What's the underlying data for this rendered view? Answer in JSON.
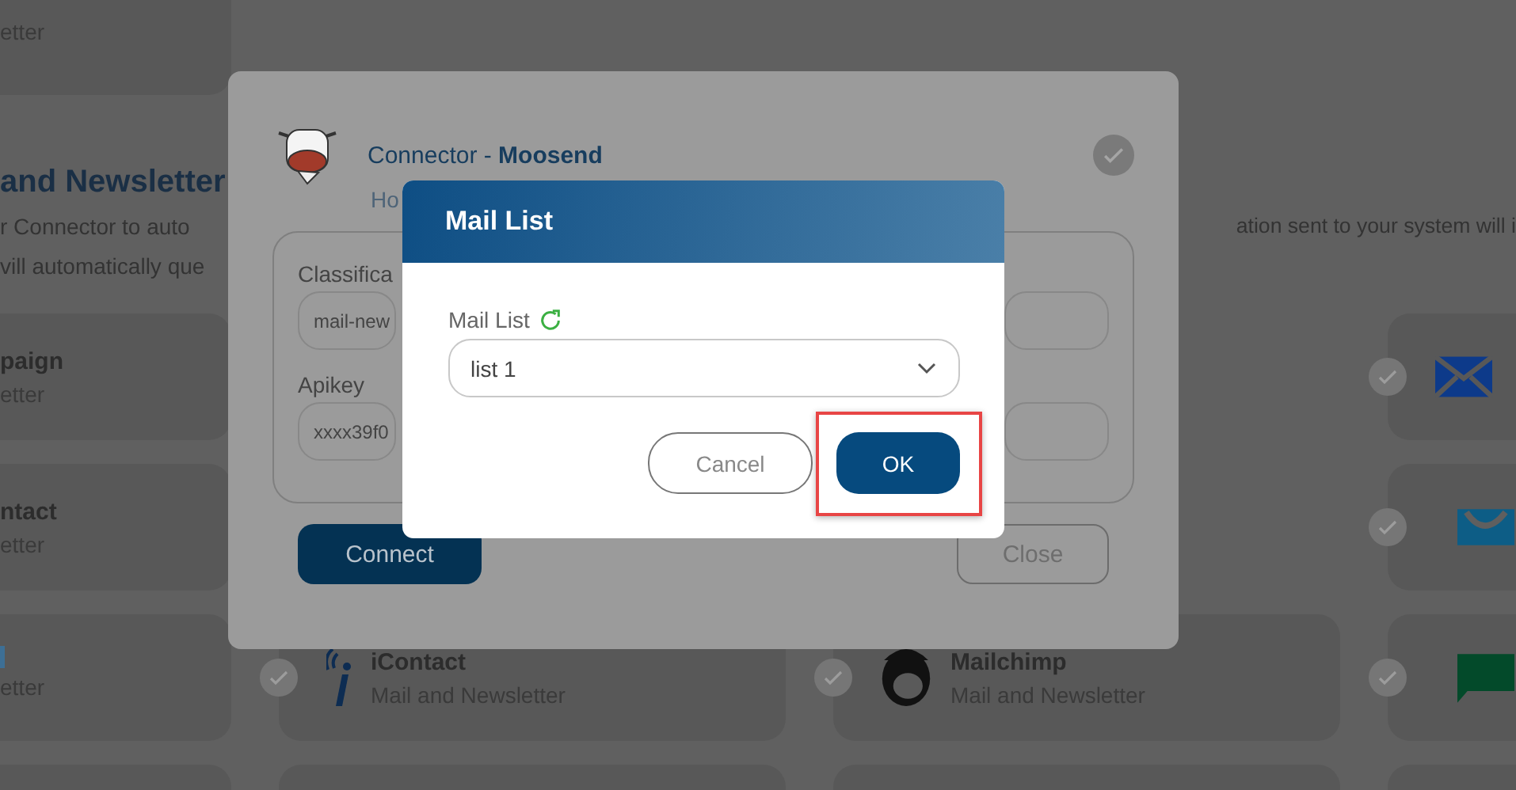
{
  "background": {
    "top_card": {
      "subtitle": "etter"
    },
    "heading": "and Newsletter",
    "description_left": [
      "r Connector to auto",
      "vill automatically que"
    ],
    "description_right": "ation sent to your system will i",
    "rows": [
      {
        "left": {
          "title": "paign",
          "subtitle": "etter"
        },
        "middle": [],
        "right": {
          "kind": "envelope"
        }
      },
      {
        "left": {
          "title": "ntact",
          "subtitle": "etter"
        },
        "middle": [],
        "right": {
          "kind": "smile"
        }
      },
      {
        "left": {
          "subtitle": "etter",
          "logo": true
        },
        "middle": [
          {
            "title": "iContact",
            "subtitle": "Mail and Newsletter",
            "kind": "signal"
          },
          {
            "title": "Mailchimp",
            "subtitle": "Mail and Newsletter",
            "kind": "head"
          }
        ],
        "right": {
          "kind": "chat"
        }
      }
    ]
  },
  "connector": {
    "title_prefix": "Connector - ",
    "title_name": "Moosend",
    "link": "Ho",
    "fields": [
      {
        "label": "Classifica",
        "value": "mail-new"
      },
      {
        "label": "Apikey",
        "value": "xxxx39f0"
      }
    ],
    "connect_button": "Connect",
    "close_button": "Close"
  },
  "mail_list": {
    "title": "Mail List",
    "field_label": "Mail List",
    "value": "list 1",
    "cancel_button": "Cancel",
    "ok_button": "OK",
    "ok_highlighted": true
  }
}
